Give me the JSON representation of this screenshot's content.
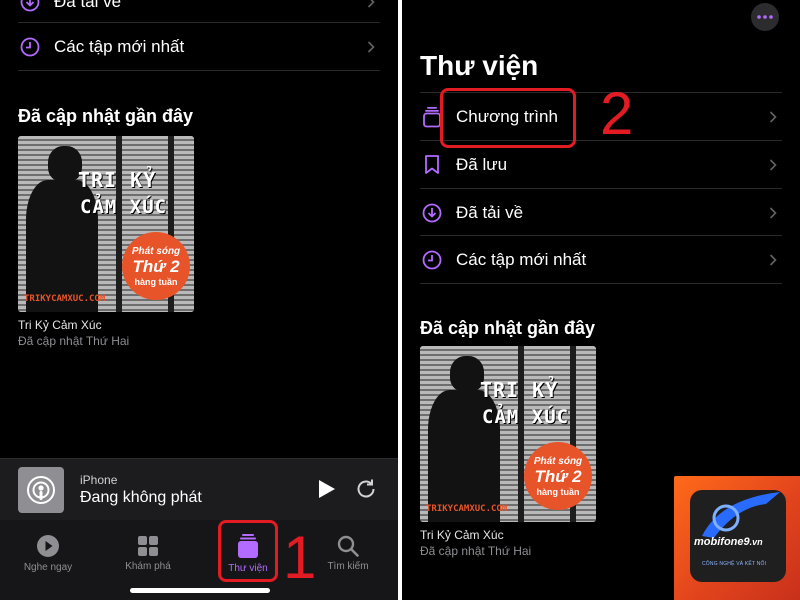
{
  "left": {
    "partial_row_label": "Đã tải về",
    "recent_row_label": "Các tập mới nhất",
    "section_title": "Đã cập nhật gần đây",
    "cover": {
      "line1": "TRI KỶ",
      "line2": "CẢM XÚC",
      "badge_top": "Phát sóng",
      "badge_mid": "Thứ 2",
      "badge_bottom": "hàng tuần",
      "url": "TRIKYCAMXUC.COM"
    },
    "podcast_name": "Tri Kỷ Cảm Xúc",
    "podcast_updated": "Đã cập nhật Thứ Hai",
    "player": {
      "device": "iPhone",
      "status": "Đang không phát"
    },
    "tabs": [
      {
        "label": "Nghe ngay",
        "icon": "play-circle-icon"
      },
      {
        "label": "Khám phá",
        "icon": "grid-icon"
      },
      {
        "label": "Thư viện",
        "icon": "library-icon",
        "active": true
      },
      {
        "label": "Tìm kiếm",
        "icon": "search-icon"
      }
    ],
    "step_number": "1"
  },
  "right": {
    "title": "Thư viện",
    "items": [
      {
        "label": "Chương trình",
        "icon": "shows-icon"
      },
      {
        "label": "Đã lưu",
        "icon": "bookmark-icon"
      },
      {
        "label": "Đã tải về",
        "icon": "download-icon"
      },
      {
        "label": "Các tập mới nhất",
        "icon": "clock-icon"
      }
    ],
    "section_title": "Đã cập nhật gần đây",
    "cover": {
      "line1": "TRI KỶ",
      "line2": "CẢM XÚC",
      "badge_top": "Phát sóng",
      "badge_mid": "Thứ 2",
      "badge_bottom": "hàng tuần",
      "url": "TRIKYCAMXUC.COM"
    },
    "podcast_name": "Tri Kỷ Cảm Xúc",
    "podcast_updated": "Đã cập nhật Thứ Hai",
    "step_number": "2"
  },
  "watermark": {
    "brand": "mobifone9",
    "domain": ".vn",
    "tagline": "CÔNG NGHỆ VÀ KẾT NỐI"
  },
  "colors": {
    "accent": "#b36bff",
    "highlight": "#e31b23",
    "background": "#000000"
  }
}
